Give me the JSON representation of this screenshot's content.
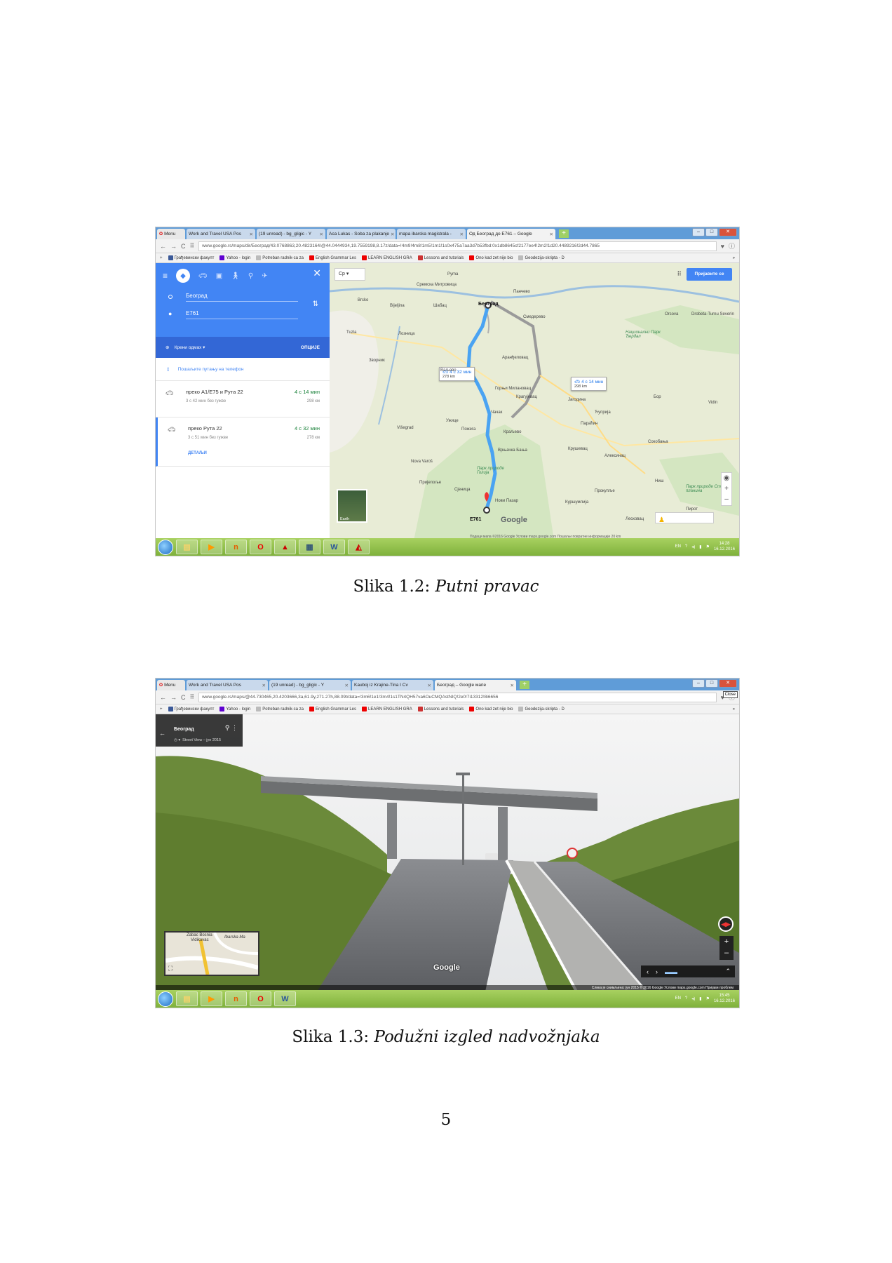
{
  "figure1": {
    "tabs": [
      "Menu",
      "Work and Travel USA Pos",
      "(19 unread) - bg_gligic - Y",
      "Aca Lukas - Soba za plakanje",
      "mapa ibarska magistrala -",
      "Од Београд до Е761 – Google"
    ],
    "url": "www.google.rs/maps/dir/Београд/43.0768863,20.4823164/@44.0444934,19.7559198,8.17z/data=!4m9!4m8!1m5!1m1!1s0x475a7aa3d7b53fbd:0x1db8645cf2177ee4!2m2!1d20.4489216!2d44.7865",
    "bookmarks": [
      "Грађевински факулт",
      "Yahoo - login",
      "Potreban radnik-ca za",
      "English Grammar Les",
      "LEARN ENGLISH GRA",
      "Lessons and tutorials",
      "Ono kad zet nije bio",
      "Geodezija-skripta - D"
    ],
    "origin": "Београд",
    "destination": "E761",
    "depart": "Крени одмах",
    "options": "ОПЦИЈЕ",
    "send_to_phone": "Пошаљите путању на телефон",
    "routes": [
      {
        "name": "преко A1/E75 и Рута 22",
        "time": "4 с 14 мин",
        "sub": "3 с 42 мин без гужве",
        "dist": "298 км"
      },
      {
        "name": "преко Рута 22",
        "time": "4 с 32 мин",
        "sub": "3 с 51 мин без гужве",
        "dist": "278 км",
        "details": "ДЕТАЉИ"
      }
    ],
    "lang": "Ср",
    "signin": "Пријавите се",
    "bubble1": {
      "time": "4 с 32 мин",
      "dist": "278 km"
    },
    "bubble2": {
      "time": "4 с 14 мин",
      "dist": "298 km"
    },
    "places": [
      "Београд",
      "Панчево",
      "Смедерево",
      "Шабац",
      "Руma",
      "Сремска Митровица",
      "Лозница",
      "Ваљево",
      "Аранђеловац",
      "Крагујевац",
      "Горњи Милановац",
      "Чачак",
      "Краљево",
      "Врњачка Бања",
      "Ужице",
      "Пожега",
      "Нови Пазар",
      "Крушевац",
      "Параћин",
      "Ћуприја",
      "Јагодина",
      "Бор",
      "Ниш",
      "Прокупље",
      "Лесковац",
      "Куршумлија",
      "Зворник",
      "Tuzla",
      "Bijeljina",
      "Brcko",
      "Višegrad",
      "Сјеница",
      "Пријепоље",
      "Nova Varoš",
      "Vidin",
      "Orsova",
      "Drobeta-Turnu Severin",
      "Сокобања",
      "Алексинац",
      "Пирот",
      "Парк природе Голија",
      "Парк природе Стара планина",
      "Национални Парк Ђердап",
      "Earth",
      "E761"
    ],
    "footer": "Подаци мапа ©2016 Google   Услови   maps.google.com   Пошаљи повратне информације   20 km",
    "taskbar": {
      "lang": "EN",
      "time": "14:28",
      "date": "16.12.2016"
    }
  },
  "figure2": {
    "tabs": [
      "Menu",
      "Work and Travel USA Pos",
      "(19 unread) - bg_gligic - Y",
      "Kauboj iz Krajine-Tina I Cv",
      "Београд – Google мапе"
    ],
    "url": "www.google.rs/maps/@44.730465,20.4203666,3a,61.9y,271.27h,88.09t/data=!3m6!1e1!3m4!1s1TN4QH57va6OuCMQAstNIQ!2e0!7i13312!8i6656",
    "close_tip": "Close",
    "card_title": "Београд",
    "card_sub": "Street View – јун 2015",
    "minimap_labels": [
      "Zabac Bosnia",
      "Vidikovac",
      "Ibarska Ma"
    ],
    "google": "Google",
    "footer": "Слика је снимљена: јун 2015   © 2016 Google   Услови   maps.google.com   Пријави проблем",
    "taskbar": {
      "lang": "EN",
      "time": "15:45",
      "date": "16.12.2016"
    }
  },
  "caption1": {
    "label": "Slika 1.2:",
    "text": "Putni pravac"
  },
  "caption2": {
    "label": "Slika 1.3:",
    "text": "Podužni izgled nadvožnjaka"
  },
  "page_number": "5"
}
